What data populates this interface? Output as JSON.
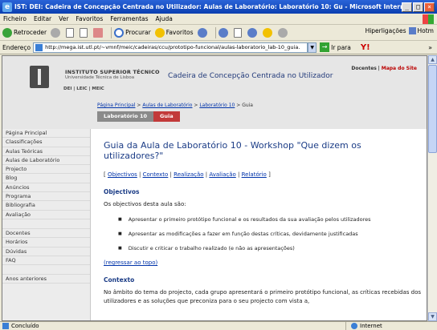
{
  "window": {
    "title": "IST: DEI: Cadeira de Concepção Centrada no Utilizador: Aulas de Laboratório: Laboratório 10: Gu - Microsoft Internet Explorer",
    "controls": [
      "_",
      "□",
      "×"
    ]
  },
  "menu": [
    "Ficheiro",
    "Editar",
    "Ver",
    "Favoritos",
    "Ferramentas",
    "Ajuda"
  ],
  "toolbar": {
    "back": "Retroceder",
    "search": "Procurar",
    "favorites": "Favoritos",
    "links": "Hiperligações",
    "links_item": "Hotm"
  },
  "address": {
    "label": "Endereço",
    "url": "http://mega.ist.utl.pt/~vmnf/meic/cadeiras/ccu/prototipo-funcional/aulas-laboratorio_lab-10_guia.",
    "go": "Ir para",
    "yahoo": "Y!"
  },
  "header": {
    "inst_name": "INSTITUTO SUPERIOR TÉCNICO",
    "inst_sub": "Universidade Técnica de Lisboa",
    "dept_links": "DEI | LEIC | MEIC",
    "course_title": "Cadeira de Concepção Centrada no Utilizador",
    "toplink_a": "Docentes",
    "toplink_sep": " | ",
    "toplink_b": "Mapa do Site"
  },
  "breadcrumb": {
    "items": [
      "Página Principal",
      "Aulas de Laboratório",
      "Laboratório 10"
    ],
    "sep": " > ",
    "current": "Guia"
  },
  "tabs": [
    "Laboratório 10",
    "Guia"
  ],
  "sidebar": {
    "items": [
      "Página Principal",
      "Classificações",
      "Aulas Teóricas",
      "Aulas de Laboratório",
      "Projecto",
      "Blog",
      "Anúncios",
      "Programa",
      "Bibliografia",
      "Avaliação"
    ],
    "items2": [
      "Docentes",
      "Horários",
      "Dúvidas",
      "FAQ"
    ],
    "items3": [
      "Anos anteriores"
    ]
  },
  "main": {
    "title": "Guia da Aula de Laboratório 10 - Workshop \"Que dizem os utilizadores?\"",
    "anchors": [
      "Objectivos",
      "Contexto",
      "Realização",
      "Avaliação",
      "Relatório"
    ],
    "section1_title": "Objectivos",
    "section1_intro": "Os objectivos desta aula são:",
    "bullets": [
      "Apresentar o primeiro protótipo funcional e os resultados da sua avaliação pelos utilizadores",
      "Apresentar as modificações a fazer em função destas críticas, devidamente justificadas",
      "Discutir e criticar o trabalho realizado (e não as apresentações)"
    ],
    "back_link": "(regressar ao topo)",
    "section2_title": "Contexto",
    "section2_text": "No âmbito do tema do projecto, cada grupo apresentará o primeiro protótipo funcional, as críticas recebidas dos utilizadores e as soluções que preconiza para o seu projecto com vista a,"
  },
  "status": {
    "left": "Concluído",
    "zone": "Internet"
  }
}
